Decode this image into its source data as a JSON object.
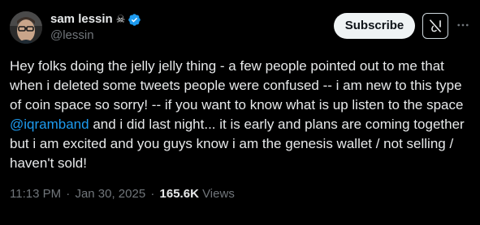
{
  "author": {
    "display_name": "sam lessin",
    "handle": "@lessin",
    "name_emoji": "☠",
    "verified": true
  },
  "actions": {
    "subscribe_label": "Subscribe",
    "more_icon": "more-icon",
    "grok_icon": "grok-icon"
  },
  "tweet": {
    "text_before_mention": "Hey folks doing the jelly jelly thing - a few people pointed out to me that when i deleted some tweets people were confused -- i am new to this type of coin space so sorry! -- if you want to know what is up listen to the space ",
    "mention": "@iqramband",
    "text_after_mention": " and i did last night... it is early and plans are coming together but i am excited and you guys know i am the genesis wallet / not selling / haven't sold!",
    "time": "11:13 PM",
    "date": "Jan 30, 2025",
    "views_count": "165.6K",
    "views_label": "Views"
  },
  "colors": {
    "background": "#000000",
    "text": "#e7e9ea",
    "secondary": "#71767b",
    "link": "#1d9bf0",
    "verified": "#1d9bf0"
  }
}
